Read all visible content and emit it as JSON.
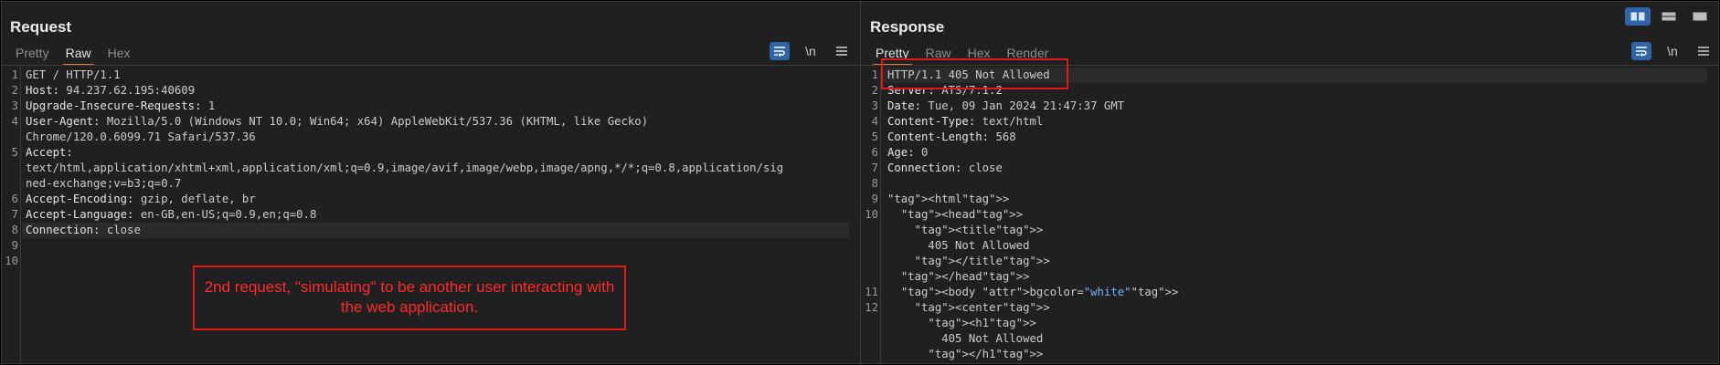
{
  "request": {
    "title": "Request",
    "tabs": [
      "Pretty",
      "Raw",
      "Hex"
    ],
    "active_tab": "Raw",
    "lines": [
      {
        "n": "1",
        "text": "GET / HTTP/1.1"
      },
      {
        "n": "2",
        "text": "Host: 94.237.62.195:40609"
      },
      {
        "n": "3",
        "text": "Upgrade-Insecure-Requests: 1"
      },
      {
        "n": "4",
        "text": "User-Agent: Mozilla/5.0 (Windows NT 10.0; Win64; x64) AppleWebKit/537.36 (KHTML, like Gecko)"
      },
      {
        "n": "",
        "text": "Chrome/120.0.6099.71 Safari/537.36"
      },
      {
        "n": "5",
        "text": "Accept:"
      },
      {
        "n": "",
        "text": "text/html,application/xhtml+xml,application/xml;q=0.9,image/avif,image/webp,image/apng,*/*;q=0.8,application/sig"
      },
      {
        "n": "",
        "text": "ned-exchange;v=b3;q=0.7"
      },
      {
        "n": "6",
        "text": "Accept-Encoding: gzip, deflate, br"
      },
      {
        "n": "7",
        "text": "Accept-Language: en-GB,en-US;q=0.9,en;q=0.8"
      },
      {
        "n": "8",
        "text": "Connection: close"
      },
      {
        "n": "9",
        "text": ""
      },
      {
        "n": "10",
        "text": ""
      }
    ],
    "annotation": "2nd request, \"simulating\" to be another user interacting with the web application."
  },
  "response": {
    "title": "Response",
    "tabs": [
      "Pretty",
      "Raw",
      "Hex",
      "Render"
    ],
    "active_tab": "Pretty",
    "lines": [
      {
        "n": "1",
        "text": "HTTP/1.1 405 Not Allowed"
      },
      {
        "n": "2",
        "text": "Server: ATS/7.1.2"
      },
      {
        "n": "3",
        "text": "Date: Tue, 09 Jan 2024 21:47:37 GMT"
      },
      {
        "n": "4",
        "text": "Content-Type: text/html"
      },
      {
        "n": "5",
        "text": "Content-Length: 568"
      },
      {
        "n": "6",
        "text": "Age: 0"
      },
      {
        "n": "7",
        "text": "Connection: close"
      },
      {
        "n": "8",
        "text": ""
      },
      {
        "n": "9",
        "text": "<html>"
      },
      {
        "n": "10",
        "text": "  <head>"
      },
      {
        "n": "",
        "text": "    <title>"
      },
      {
        "n": "",
        "text": "      405 Not Allowed"
      },
      {
        "n": "",
        "text": "    </title>"
      },
      {
        "n": "",
        "text": "  </head>"
      },
      {
        "n": "11",
        "text": "  <body bgcolor=\"white\">"
      },
      {
        "n": "12",
        "text": "    <center>"
      },
      {
        "n": "",
        "text": "      <h1>"
      },
      {
        "n": "",
        "text": "        405 Not Allowed"
      },
      {
        "n": "",
        "text": "      </h1>"
      }
    ]
  },
  "toolbar": {
    "wrap_icon": "text-wrap-icon",
    "newline_label": "\\n",
    "menu_icon": "hamburger-menu-icon"
  },
  "layout_buttons": [
    "split-horizontal-icon",
    "split-vertical-icon",
    "single-pane-icon"
  ],
  "colors": {
    "accent": "#2f64a8",
    "tab_underline": "#e8743b",
    "annotation": "#e01818"
  }
}
